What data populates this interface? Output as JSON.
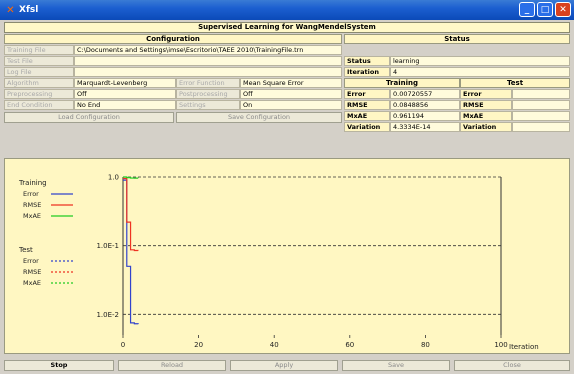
{
  "window": {
    "title": "Xfsl"
  },
  "header": {
    "title": "Supervised Learning for WangMendelSystem"
  },
  "config": {
    "heading": "Configuration",
    "rows": [
      {
        "label": "Training File",
        "value": "C:\\Documents and Settings\\imse\\Escritorio\\TAEE 2010\\TrainingFile.trn"
      },
      {
        "label": "Test File",
        "value": ""
      },
      {
        "label": "Log File",
        "value": ""
      }
    ],
    "algorithm": {
      "label": "Algorithm",
      "value": "Marquardt-Levenberg"
    },
    "error_function": {
      "label": "Error Function",
      "value": "Mean Square Error"
    },
    "preprocessing": {
      "label": "Preprocessing",
      "value": "Off"
    },
    "postprocessing": {
      "label": "Postprocessing",
      "value": "Off"
    },
    "end_condition": {
      "label": "End Condition",
      "value": "No End"
    },
    "settings": {
      "label": "Settings",
      "value": "On"
    },
    "load_button": "Load Configuration",
    "save_button": "Save Configuration"
  },
  "status": {
    "heading": "Status",
    "status_label": "Status",
    "status_value": "learning",
    "iteration_label": "Iteration",
    "iteration_value": "4",
    "training_heading": "Training",
    "test_heading": "Test",
    "rows": [
      {
        "label": "Error",
        "training": "0.00720557",
        "test_label": "Error",
        "test": ""
      },
      {
        "label": "RMSE",
        "training": "0.0848856",
        "test_label": "RMSE",
        "test": ""
      },
      {
        "label": "MxAE",
        "training": "0.961194",
        "test_label": "MxAE",
        "test": ""
      },
      {
        "label": "Variation",
        "training": "4.3334E-14",
        "test_label": "Variation",
        "test": ""
      }
    ]
  },
  "legend": {
    "training_title": "Training",
    "test_title": "Test",
    "training_items": [
      {
        "name": "Error",
        "color": "#3344cc",
        "dashed": false
      },
      {
        "name": "RMSE",
        "color": "#ee3322",
        "dashed": false
      },
      {
        "name": "MxAE",
        "color": "#22cc22",
        "dashed": false
      }
    ],
    "test_items": [
      {
        "name": "Error",
        "color": "#3344cc",
        "dashed": true
      },
      {
        "name": "RMSE",
        "color": "#ee3322",
        "dashed": true
      },
      {
        "name": "MxAE",
        "color": "#22cc22",
        "dashed": true
      }
    ]
  },
  "chart_data": {
    "type": "line",
    "xlabel": "Iteration",
    "xlim": [
      0,
      100
    ],
    "xticks": [
      "0",
      "20",
      "40",
      "60",
      "80",
      "100"
    ],
    "yscale": "log",
    "ylim": [
      0.005,
      1.0
    ],
    "yticks": [
      "1.0",
      "1.0E-1",
      "1.0E-2"
    ],
    "ytick_values": [
      1.0,
      0.1,
      0.01
    ],
    "series": [
      {
        "name": "Error",
        "x": [
          0,
          1,
          2,
          3,
          4
        ],
        "values": [
          0.9,
          0.05,
          0.0075,
          0.0073,
          0.0072
        ],
        "color": "#3344cc"
      },
      {
        "name": "RMSE",
        "x": [
          0,
          1,
          2,
          3,
          4
        ],
        "values": [
          0.95,
          0.22,
          0.087,
          0.085,
          0.0849
        ],
        "color": "#ee3322"
      },
      {
        "name": "MxAE",
        "x": [
          0,
          1,
          2,
          3,
          4
        ],
        "values": [
          1.0,
          0.98,
          0.965,
          0.962,
          0.961
        ],
        "color": "#22cc22"
      }
    ],
    "grid": "dashed horizontal at ticks"
  },
  "buttons": {
    "stop": "Stop",
    "reload": "Reload",
    "apply": "Apply",
    "save": "Save",
    "close": "Close"
  }
}
